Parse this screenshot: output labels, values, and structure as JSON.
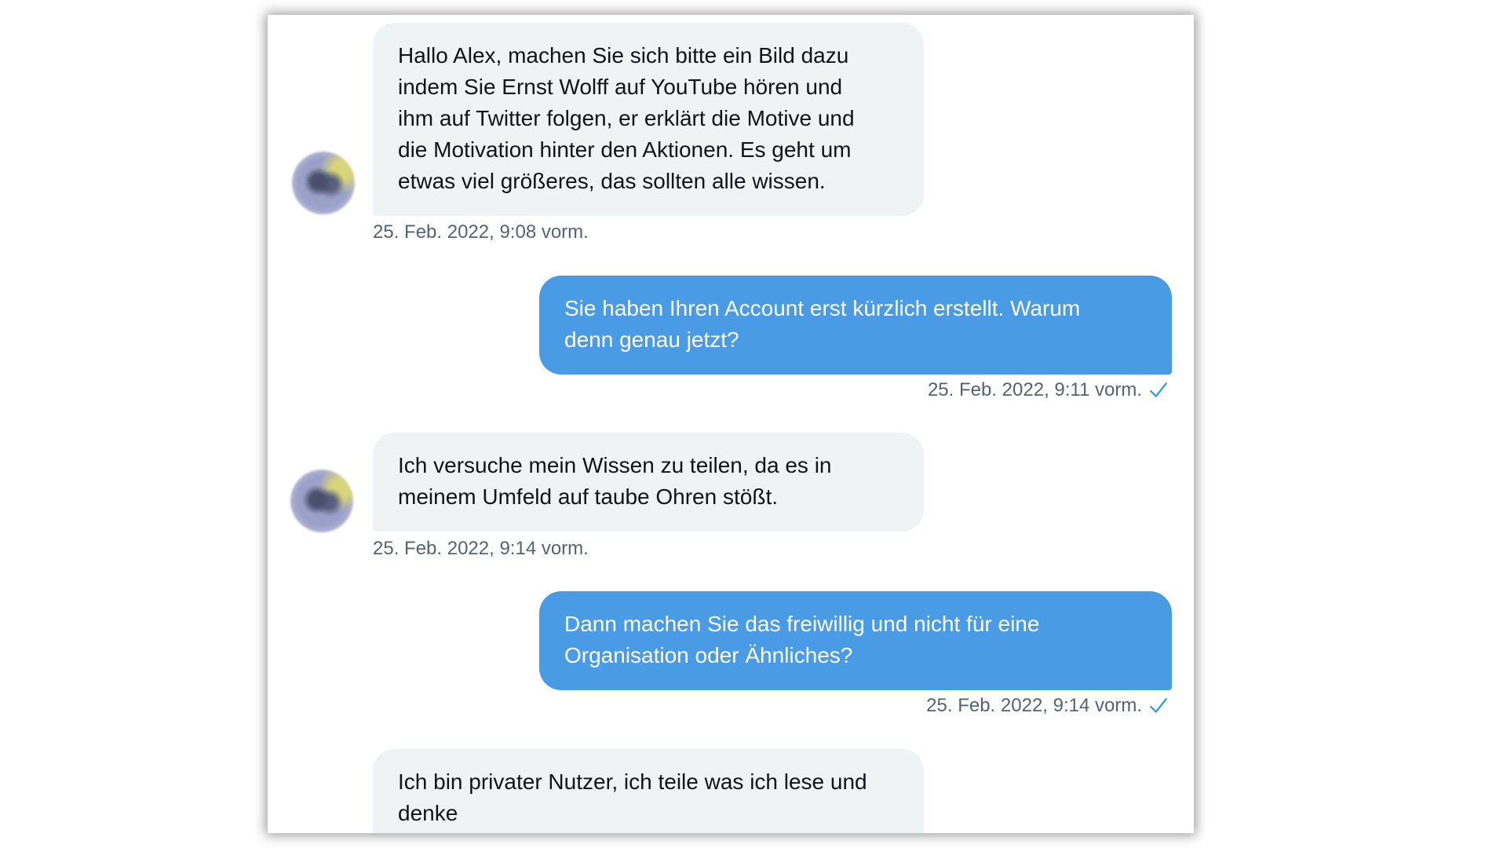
{
  "conversation": {
    "messages": [
      {
        "direction": "in",
        "text": "Hallo Alex, machen Sie sich bitte ein Bild dazu\nindem Sie Ernst Wolff auf YouTube hören und\nihm auf Twitter folgen, er erklärt die Motive und\ndie Motivation  hinter den Aktionen. Es geht um\netwas viel größeres, das sollten alle wissen.",
        "timestamp": "25. Feb. 2022, 9:08 vorm."
      },
      {
        "direction": "out",
        "text": "Sie haben Ihren Account erst kürzlich erstellt. Warum\ndenn genau jetzt?",
        "timestamp": "25. Feb. 2022, 9:11 vorm.",
        "status_icon": "checkmark-icon"
      },
      {
        "direction": "in",
        "text": "Ich versuche mein Wissen zu teilen, da es in\nmeinem Umfeld auf taube Ohren stößt.",
        "timestamp": "25. Feb. 2022, 9:14 vorm."
      },
      {
        "direction": "out",
        "text": "Dann machen Sie das freiwillig und nicht für eine\nOrganisation oder Ähnliches?",
        "timestamp": "25. Feb. 2022, 9:14 vorm.",
        "status_icon": "checkmark-icon"
      },
      {
        "direction": "in",
        "text": "Ich bin privater Nutzer, ich teile was ich lese und\ndenke",
        "timestamp": ""
      }
    ]
  },
  "colors": {
    "incoming_bubble": "#eff3f4",
    "outgoing_bubble": "#4a9be6",
    "timestamp_text": "#536471",
    "checkmark": "#1d9bf0"
  }
}
